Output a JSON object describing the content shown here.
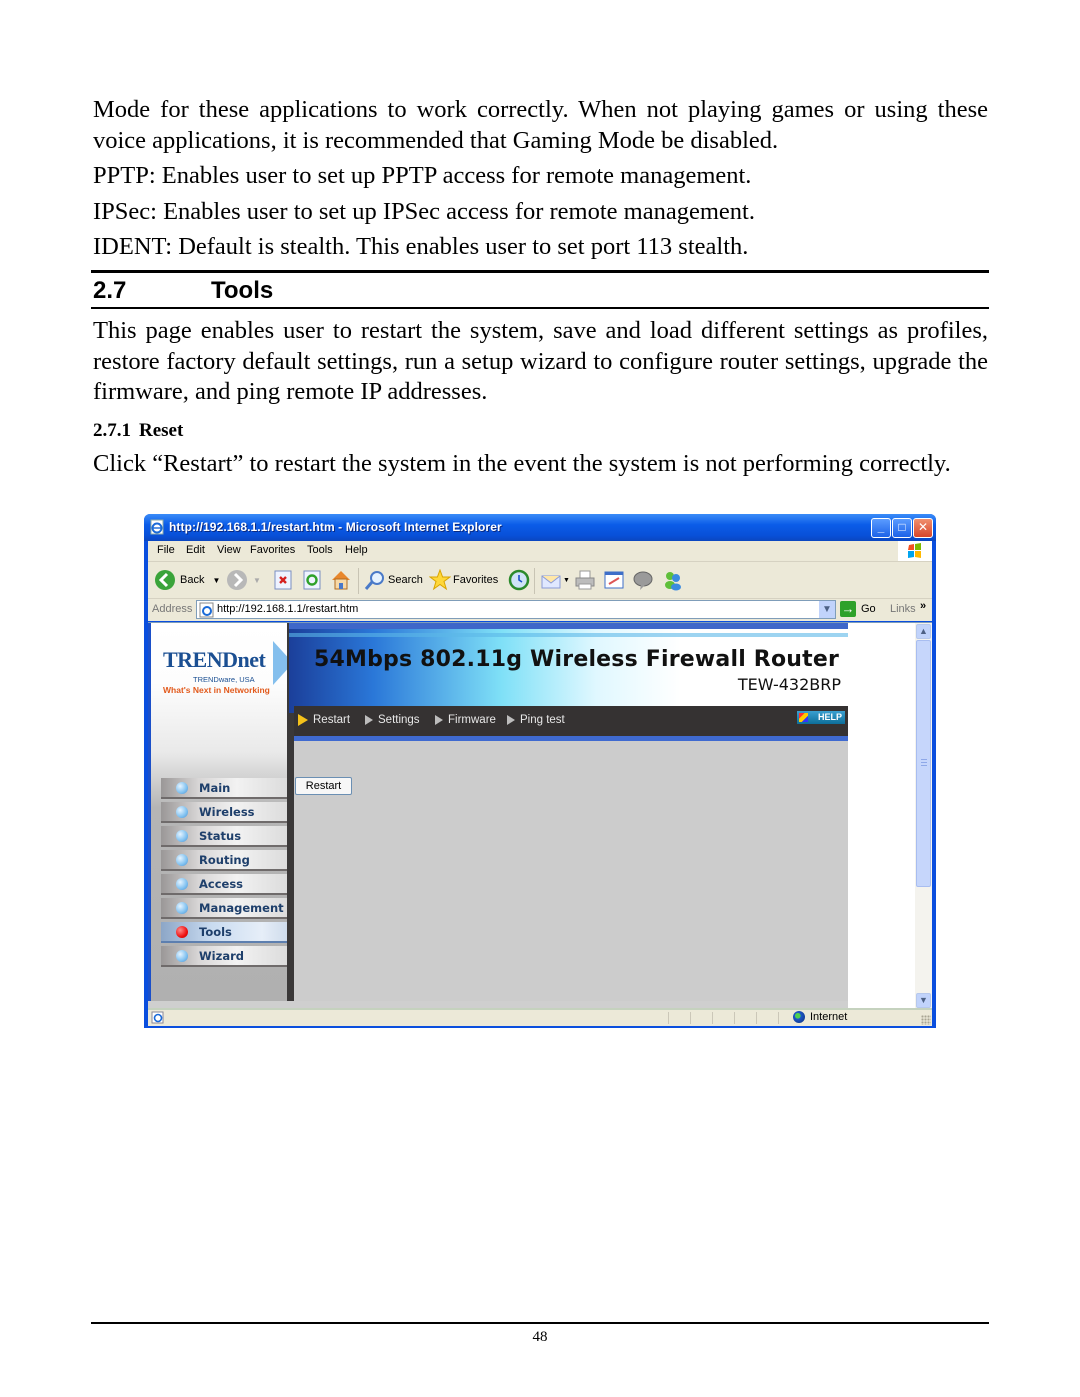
{
  "document": {
    "intro_paragraph": "Mode for these applications to work correctly. When not playing games or using these voice applications, it is recommended that Gaming Mode be disabled.",
    "pptp_line": "PPTP: Enables user to set up PPTP access for remote management.",
    "ipsec_line": "IPSec: Enables user to set up IPSec access for remote management.",
    "ident_line": "IDENT: Default is stealth.  This enables user to set port 113 stealth.",
    "section": {
      "number": "2.7",
      "title": "Tools",
      "body": "This page enables user to restart the system, save and load different settings as profiles, restore factory default settings, run a setup wizard to configure router settings, upgrade the firmware, and ping remote IP addresses."
    },
    "subsection": {
      "number": "2.7.1",
      "title": "Reset",
      "body": "Click “Restart” to restart the system in the event the system is not performing correctly."
    },
    "page_number": "48"
  },
  "browser": {
    "window_title": "http://192.168.1.1/restart.htm - Microsoft Internet Explorer",
    "window_buttons": [
      "minimize",
      "maximize",
      "close"
    ],
    "menu": [
      "File",
      "Edit",
      "View",
      "Favorites",
      "Tools",
      "Help"
    ],
    "toolbar": {
      "back_label": "Back",
      "search_label": "Search",
      "favorites_label": "Favorites"
    },
    "address": {
      "label": "Address",
      "url": "http://192.168.1.1/restart.htm",
      "go_label": "Go",
      "links_label": "Links",
      "links_chevron": "»"
    },
    "status": {
      "zone_label": "Internet"
    }
  },
  "router_page": {
    "logo": {
      "brand": "TRENDnet",
      "registered": "®",
      "subtitle": "TRENDware, USA",
      "tagline": "What's Next in Networking"
    },
    "banner": {
      "title": "54Mbps 802.11g Wireless Firewall Router",
      "model": "TEW-432BRP"
    },
    "subnav": [
      {
        "label": "Restart",
        "active": true
      },
      {
        "label": "Settings",
        "active": false
      },
      {
        "label": "Firmware",
        "active": false
      },
      {
        "label": "Ping test",
        "active": false
      }
    ],
    "help_label": "HELP",
    "restart_button": "Restart",
    "side_menu": [
      {
        "label": "Main",
        "active": false
      },
      {
        "label": "Wireless",
        "active": false
      },
      {
        "label": "Status",
        "active": false
      },
      {
        "label": "Routing",
        "active": false
      },
      {
        "label": "Access",
        "active": false
      },
      {
        "label": "Management",
        "active": false
      },
      {
        "label": "Tools",
        "active": true
      },
      {
        "label": "Wizard",
        "active": false
      }
    ]
  }
}
